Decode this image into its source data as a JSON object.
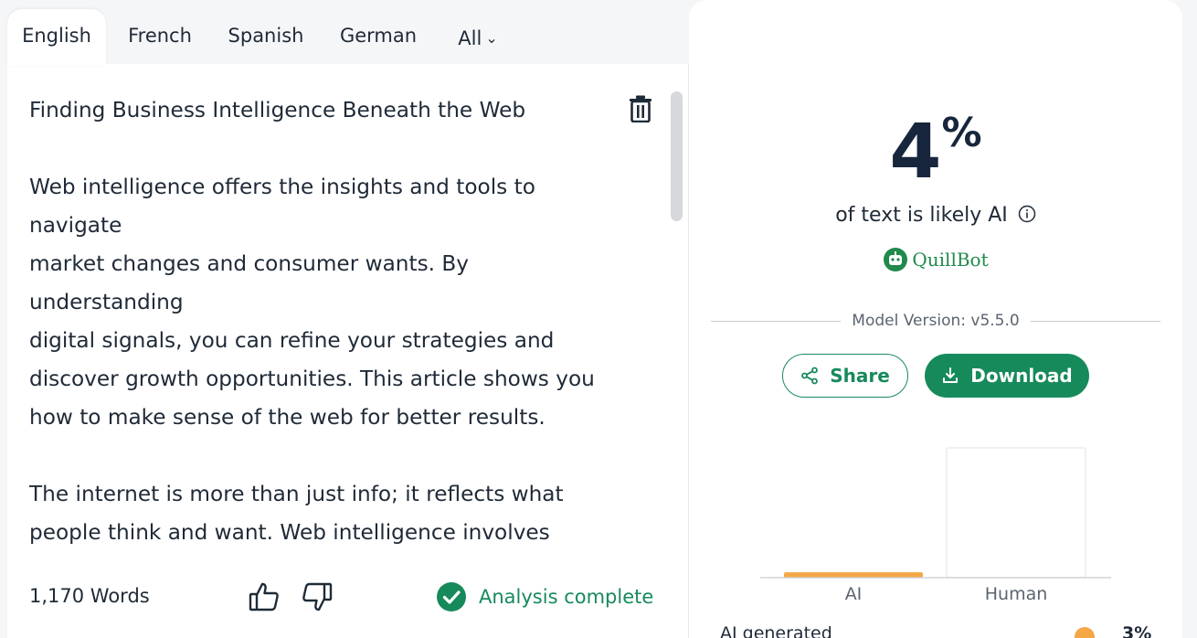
{
  "tabs": [
    {
      "label": "English",
      "active": true
    },
    {
      "label": "French",
      "active": false
    },
    {
      "label": "Spanish",
      "active": false
    },
    {
      "label": "German",
      "active": false
    },
    {
      "label": "All",
      "active": false
    }
  ],
  "editor": {
    "title": "Finding Business Intelligence Beneath the Web",
    "paragraphs": [
      "Web intelligence offers the insights and tools to navigate\nmarket changes and consumer wants. By understanding\ndigital signals, you can refine your strategies and\ndiscover growth opportunities. This article shows you\nhow to make sense of the web for better results.",
      "The internet is more than just info; it reflects what\npeople think and want. Web intelligence involves\ngathering and analyzing this data to give you insights\ninto your competition and audience. By using a"
    ]
  },
  "footer": {
    "word_count": "1,170 Words",
    "status": "Analysis complete"
  },
  "result": {
    "percent": "4",
    "percent_sign": "%",
    "likely_text": "of text is likely AI",
    "brand": "QuillBot",
    "model_version": "Model Version: v5.5.0",
    "share_label": "Share",
    "download_label": "Download",
    "ai_generated_label": "AI generated",
    "ai_generated_pct": "3%"
  },
  "colors": {
    "accent": "#178a5b",
    "ai_bar": "#f5a746",
    "text_dark": "#17263d"
  },
  "chart_data": {
    "type": "bar",
    "categories": [
      "AI",
      "Human"
    ],
    "values": [
      4,
      96
    ],
    "ylim": [
      0,
      100
    ]
  }
}
